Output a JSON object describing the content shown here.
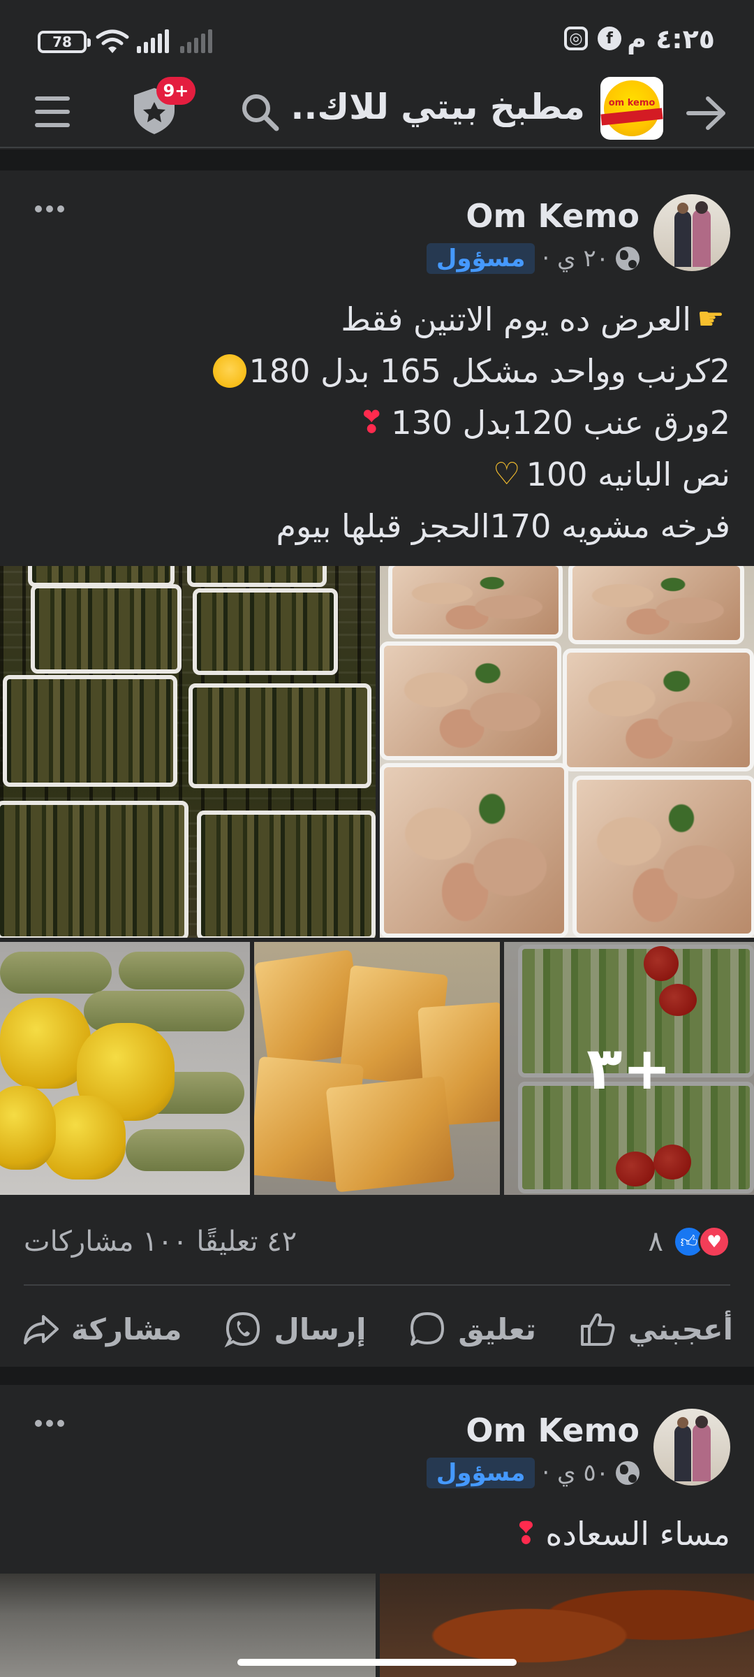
{
  "status_bar": {
    "time": "٤:٢٥ م",
    "battery": "78",
    "social_icons": [
      "facebook-icon",
      "instagram-icon"
    ]
  },
  "header": {
    "title": "مطبخ بيتي للاك...",
    "badge": "9+",
    "logo_text": "om kemo",
    "icons": [
      "back-arrow-icon",
      "search-icon",
      "shield-icon",
      "menu-icon"
    ]
  },
  "posts": [
    {
      "author": "Om Kemo",
      "role": "مسؤول",
      "time": "٢٠ ي ·",
      "text_lines": [
        "العرض ده يوم الاتنين فقط",
        "2كرنب وواحد مشكل 165 بدل 180",
        "2ورق عنب 120بدل 130",
        "نص البانيه 100",
        "فرخه مشويه 170الحجز قبلها بيوم"
      ],
      "more_photos": "+٣",
      "reaction_count": "٨",
      "stats": "٤٢ تعليقًا ١٠٠ مشاركات"
    },
    {
      "author": "Om Kemo",
      "role": "مسؤول",
      "time": "٥٠ ي ·",
      "text_lines": [
        "مساء السعاده"
      ]
    }
  ],
  "actions": {
    "like": "أعجبني",
    "comment": "تعليق",
    "send": "إرسال",
    "share": "مشاركة"
  },
  "colors": {
    "background": "#242526",
    "divider": "#18191a",
    "accent_blue": "#1877f2",
    "badge_red": "#e41e3f",
    "role_text": "#4599ff"
  }
}
